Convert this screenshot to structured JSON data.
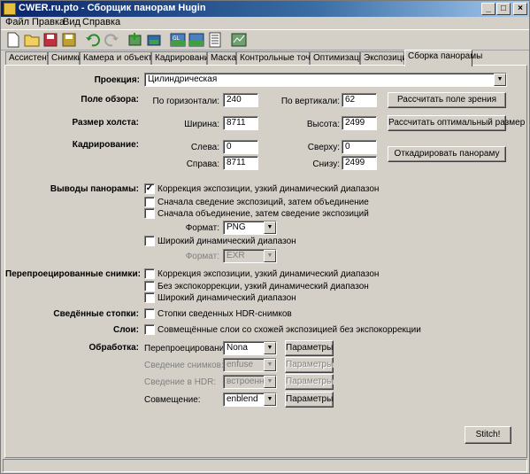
{
  "window": {
    "title": "CWER.ru.pto - Сборщик панорам Hugin",
    "minimize": "_",
    "maximize": "□",
    "close": "×"
  },
  "menu": {
    "file": "Файл",
    "edit": "Правка",
    "view": "Вид",
    "help": "Справка"
  },
  "tabs": [
    "Ассистент",
    "Снимки",
    "Камера и объектив",
    "Кадрирование",
    "Маска",
    "Контрольные точки",
    "Оптимизация",
    "Экспозиция",
    "Сборка панорамы"
  ],
  "projection": {
    "label": "Проекция:",
    "value": "Цилиндрическая"
  },
  "fov": {
    "label": "Поле обзора:",
    "h_label": "По горизонтали:",
    "h_value": "240",
    "v_label": "По вертикали:",
    "v_value": "62",
    "button": "Рассчитать поле зрения"
  },
  "canvas": {
    "label": "Размер холста:",
    "w_label": "Ширина:",
    "w_value": "8711",
    "h_label": "Высота:",
    "h_value": "2499",
    "button": "Рассчитать оптимальный размер"
  },
  "crop": {
    "label": "Кадрирование:",
    "left_label": "Слева:",
    "left_value": "0",
    "top_label": "Сверху:",
    "top_value": "0",
    "right_label": "Справа:",
    "right_value": "8711",
    "bottom_label": "Снизу:",
    "bottom_value": "2499",
    "button": "Откадрировать панораму"
  },
  "outputs": {
    "label": "Выводы панорамы:",
    "opt1": "Коррекция экспозиции, узкий динамический диапазон",
    "opt2": "Сначала сведение экспозиций, затем объединение",
    "opt3": "Сначала объединение, затем сведение экспозиций",
    "format_label": "Формат:",
    "format_value": "PNG",
    "opt4": "Широкий динамический диапазон",
    "format2_label": "Формат:",
    "format2_value": "EXR"
  },
  "remapped": {
    "label": "Перепроецированные снимки:",
    "opt1": "Коррекция экспозиции, узкий динамический диапазон",
    "opt2": "Без экспокоррекции, узкий динамический диапазон",
    "opt3": "Широкий динамический диапазон"
  },
  "stacks": {
    "label": "Сведённые стопки:",
    "opt1": "Стопки сведенных HDR-снимков"
  },
  "layers": {
    "label": "Слои:",
    "opt1": "Совмещённые слои со схожей экспозицией без экспокоррекции"
  },
  "processing": {
    "label": "Обработка:",
    "remap_label": "Перепроецирование:",
    "remap_value": "Nona",
    "fuse_label": "Сведение снимков:",
    "fuse_value": "enfuse",
    "hdr_label": "Сведение в HDR:",
    "hdr_value": "встроенное",
    "blend_label": "Совмещение:",
    "blend_value": "enblend",
    "params": "Параметры"
  },
  "stitch": "Stitch!"
}
